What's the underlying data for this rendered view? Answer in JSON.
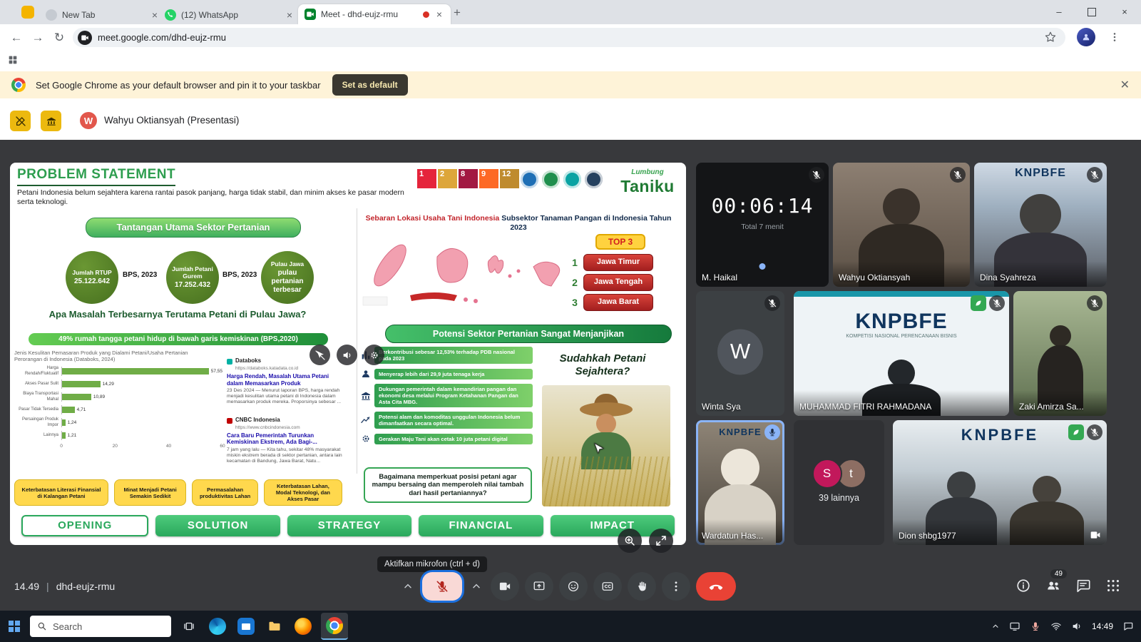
{
  "browser": {
    "tabs": [
      {
        "title": "New Tab"
      },
      {
        "title": "(12) WhatsApp"
      },
      {
        "title": "Meet - dhd-eujz-rmu"
      }
    ],
    "url": "meet.google.com/dhd-eujz-rmu",
    "default_banner": {
      "message": "Set Google Chrome as your default browser and pin it to your taskbar",
      "button_label": "Set as default"
    }
  },
  "meet": {
    "presenter_initial": "W",
    "presenter_label": "Wahyu Oktiansyah (Presentasi)",
    "footer": {
      "clock": "14.49",
      "meeting_code": "dhd-eujz-rmu",
      "mic_tooltip": "Aktifkan mikrofon (ctrl + d)",
      "participant_count": "49"
    },
    "tiles": [
      {
        "name": "M. Haikal",
        "timer": "00:06:14",
        "timer_caption": "Total 7 menit"
      },
      {
        "name": "Wahyu Oktiansyah"
      },
      {
        "name": "Dina Syahreza",
        "watermark": "KNPBFE"
      },
      {
        "name": "Winta Sya",
        "initial": "W"
      },
      {
        "name": "MUHAMMAD FITRI RAHMADANA",
        "watermark": "KNPBFE",
        "watermark_sub": "KOMPETISI NASIONAL PERENCANAAN BISNIS"
      },
      {
        "name": "Zaki Amirza Sa..."
      },
      {
        "name": "Wardatun Has...",
        "watermark": "KNPBFE"
      },
      {
        "name": "39 lainnya",
        "avatar_initials": [
          "S",
          "t"
        ]
      },
      {
        "name": "Dion shbg1977",
        "watermark": "KNPBFE"
      }
    ]
  },
  "slide": {
    "title": "PROBLEM STATEMENT",
    "subtitle": "Petani Indonesia belum sejahtera karena rantai pasok panjang, harga tidak stabil, dan minim akses ke pasar modern serta teknologi.",
    "sdg": [
      "1",
      "2",
      "8",
      "9",
      "12"
    ],
    "brand_top": "Lumbung",
    "brand": "Taniku",
    "left": {
      "challenge_banner": "Tantangan Utama Sektor Pertanian",
      "stat_circles": [
        {
          "title": "Jumlah RTUP",
          "value": "25.122.642"
        },
        {
          "title": "Jumlah Petani Gurem",
          "value": "17.252.432"
        },
        {
          "title": "Pulau Jawa",
          "value": "pulau pertanian terbesar"
        }
      ],
      "circle_sources": [
        "BPS, 2023",
        "BPS, 2023"
      ],
      "big_question": "Apa Masalah Terbesarnya Terutama Petani di Pulau Jawa?",
      "poverty_banner": "49% rumah tangga petani hidup di bawah garis kemiskinan (BPS,2020)",
      "articles": [
        {
          "source": "Databoks",
          "url": "https://databoks.katadata.co.id",
          "headline": "Harga Rendah, Masalah Utama Petani dalam Memasarkan Produk",
          "snippet": "23 Des 2024 — Menurut laporan BPS, harga rendah menjadi kesulitan utama petani di Indonesia dalam memasarkan produk mereka. Proporsinya sebesar ..."
        },
        {
          "source": "CNBC Indonesia",
          "url": "https://www.cnbcindonesia.com",
          "headline": "Cara Baru Pemerintah Turunkan Kemiskinan Ekstrem, Ada Bagi-...",
          "snippet": "7 jam yang lalu — Kita tahu, sekitar 48% masyarakat miskin ekstrem berada di sektor pertanian, antara lain kecamatan di Bandung, Jawa Barat, Natu..."
        }
      ],
      "issue_boxes": [
        "Keterbatasan Literasi Finansial di Kalangan Petani",
        "Minat Menjadi Petani Semakin Sedikit",
        "Permasalahan produktivitas Lahan",
        "Keterbatasan Lahan, Modal Teknologi, dan Akses Pasar"
      ]
    },
    "right": {
      "map_title_red": "Sebaran Lokasi Usaha Tani Indonesia",
      "map_title_dark": "Subsektor Tanaman Pangan di Indonesia Tahun 2023",
      "top3_label": "TOP 3",
      "top3_ranks": [
        "1",
        "2",
        "3"
      ],
      "top3": [
        "Jawa Timur",
        "Jawa Tengah",
        "Jawa Barat"
      ],
      "potential_banner": "Potensi Sektor Pertanian Sangat Menjanjikan",
      "potential_items": [
        "Berkontribusi sebesar 12,53% terhadap PDB nasional pada 2023",
        "Menyerap lebih dari 29,9 juta tenaga kerja",
        "Dukungan pemerintah dalam kemandirian pangan dan ekonomi desa melalui Program Ketahanan Pangan dan Asta Cita MBG.",
        "Potensi alam dan komoditas unggulan Indonesia belum dimanfaatkan secara optimal.",
        "Gerakan Maju Tani akan cetak 10 juta petani digital"
      ],
      "farmer_question": "Sudahkah Petani Sejahtera?",
      "closing_question": "Bagaimana memperkuat posisi petani agar mampu bersaing dan memperoleh nilai tambah dari hasil pertaniannya?"
    },
    "nav": [
      "OPENING",
      "SOLUTION",
      "STRATEGY",
      "FINANCIAL",
      "IMPACT"
    ]
  },
  "chart_data": {
    "type": "bar",
    "orientation": "horizontal",
    "title": "Jenis Kesulitan Pemasaran Produk yang Dialami Petani/Usaha Pertanian Perorangan di Indonesia (Databoks, 2024)",
    "categories": [
      "Harga Rendah/Fluktuatif",
      "Akses Pasar Sulit",
      "Biaya Transportasi Mahal",
      "Pasar Tidak Tersedia",
      "Persaingan Produk Impor",
      "Lainnya"
    ],
    "values": [
      57.55,
      14.29,
      10.89,
      4.71,
      1.24,
      1.21
    ],
    "value_labels": [
      "57,55",
      "14,29",
      "10,89",
      "4,71",
      "1,24",
      "1,21"
    ],
    "ticks": [
      "0",
      "20",
      "40",
      "60"
    ],
    "xlim": [
      0,
      60
    ]
  },
  "taskbar": {
    "search_placeholder": "Search",
    "clock": "14:49"
  }
}
